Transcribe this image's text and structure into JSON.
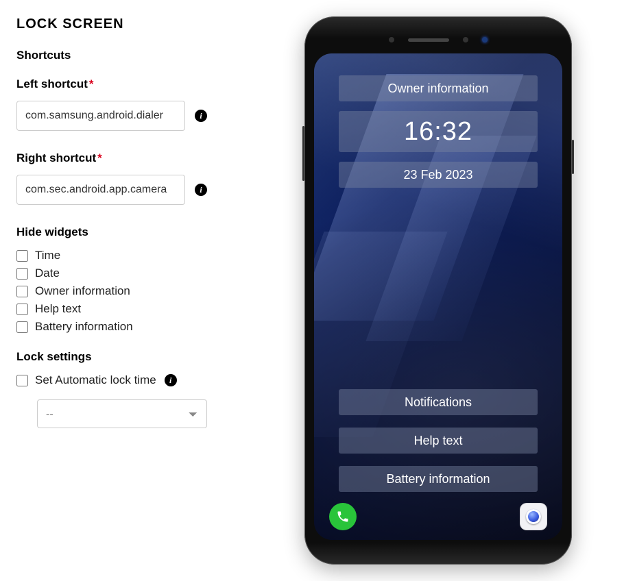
{
  "heading": "LOCK SCREEN",
  "shortcuts": {
    "title": "Shortcuts",
    "left": {
      "label": "Left shortcut",
      "value": "com.samsung.android.dialer"
    },
    "right": {
      "label": "Right shortcut",
      "value": "com.sec.android.app.camera"
    }
  },
  "hideWidgets": {
    "title": "Hide widgets",
    "items": [
      {
        "label": "Time",
        "checked": false
      },
      {
        "label": "Date",
        "checked": false
      },
      {
        "label": "Owner information",
        "checked": false
      },
      {
        "label": "Help text",
        "checked": false
      },
      {
        "label": "Battery information",
        "checked": false
      }
    ]
  },
  "lockSettings": {
    "title": "Lock settings",
    "autoLock": {
      "label": "Set Automatic lock time",
      "checked": false,
      "selected": "--"
    }
  },
  "preview": {
    "owner": "Owner information",
    "time": "16:32",
    "date": "23 Feb 2023",
    "notifications": "Notifications",
    "help": "Help text",
    "battery": "Battery information"
  }
}
